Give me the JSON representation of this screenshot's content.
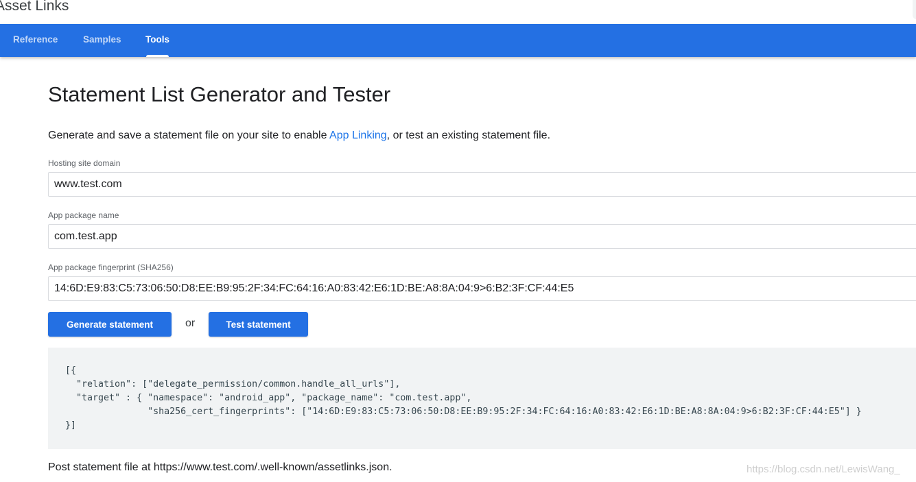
{
  "header": {
    "site_title": "Asset Links"
  },
  "nav": {
    "tabs": [
      {
        "label": "Reference",
        "active": false
      },
      {
        "label": "Samples",
        "active": false
      },
      {
        "label": "Tools",
        "active": true
      }
    ]
  },
  "main": {
    "title": "Statement List Generator and Tester",
    "intro_before": "Generate and save a statement file on your site to enable ",
    "intro_link": "App Linking",
    "intro_after": ", or test an existing statement file.",
    "fields": [
      {
        "label": "Hosting site domain",
        "value": "www.test.com"
      },
      {
        "label": "App package name",
        "value": "com.test.app"
      },
      {
        "label": "App package fingerprint (SHA256)",
        "value": "14:6D:E9:83:C5:73:06:50:D8:EE:B9:95:2F:34:FC:64:16:A0:83:42:E6:1D:BE:A8:8A:04:9>6:B2:3F:CF:44:E5"
      }
    ],
    "generate_button": "Generate statement",
    "or_text": "or",
    "test_button": "Test statement",
    "code_lines": [
      "[{",
      "  \"relation\": [\"delegate_permission/common.handle_all_urls\"],",
      "  \"target\" : { \"namespace\": \"android_app\", \"package_name\": \"com.test.app\",",
      "               \"sha256_cert_fingerprints\": [\"14:6D:E9:83:C5:73:06:50:D8:EE:B9:95:2F:34:FC:64:16:A0:83:42:E6:1D:BE:A8:8A:04:9>6:B2:3F:CF:44:E5\"] }",
      "}]"
    ],
    "post_text": "Post statement file at https://www.test.com/.well-known/assetlinks.json."
  },
  "watermark": "https://blog.csdn.net/LewisWang_",
  "colors": {
    "brand_blue": "#2470e3",
    "link_blue": "#1a73e8",
    "code_bg": "#f1f3f4"
  }
}
